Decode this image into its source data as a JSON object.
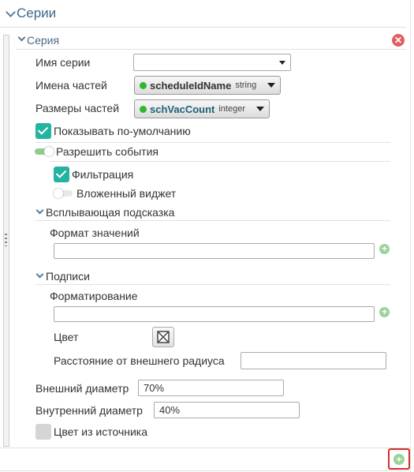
{
  "panel": {
    "title": "Серии"
  },
  "series": {
    "title": "Серия",
    "name_label": "Имя серии",
    "name_value": "",
    "parts_names_label": "Имена частей",
    "parts_names_field": "scheduleIdName",
    "parts_names_type": "string",
    "parts_sizes_label": "Размеры частей",
    "parts_sizes_field": "schVacCount",
    "parts_sizes_type": "integer",
    "show_default_label": "Показывать по-умолчанию",
    "show_default_checked": true,
    "allow_events_label": "Разрешить события",
    "allow_events_on": true,
    "filter_label": "Фильтрация",
    "filter_checked": true,
    "nested_widget_label": "Вложенный виджет",
    "nested_widget_on": false
  },
  "tooltip": {
    "title": "Всплывающая подсказка",
    "format_label": "Формат значений",
    "format_value": ""
  },
  "labels": {
    "title": "Подписи",
    "formatting_label": "Форматирование",
    "formatting_value": "",
    "color_label": "Цвет",
    "distance_label": "Расстояние от внешнего радиуса",
    "distance_value": ""
  },
  "outer_diameter": {
    "label": "Внешний диаметр",
    "value": "70%"
  },
  "inner_diameter": {
    "label": "Внутренний диаметр",
    "value": "40%"
  },
  "color_from_source": {
    "label": "Цвет из источника",
    "checked": false
  },
  "colors": {
    "accent": "#24b3a0",
    "add": "#9bd39b",
    "remove": "#e06060",
    "highlight": "#d32f2f"
  }
}
